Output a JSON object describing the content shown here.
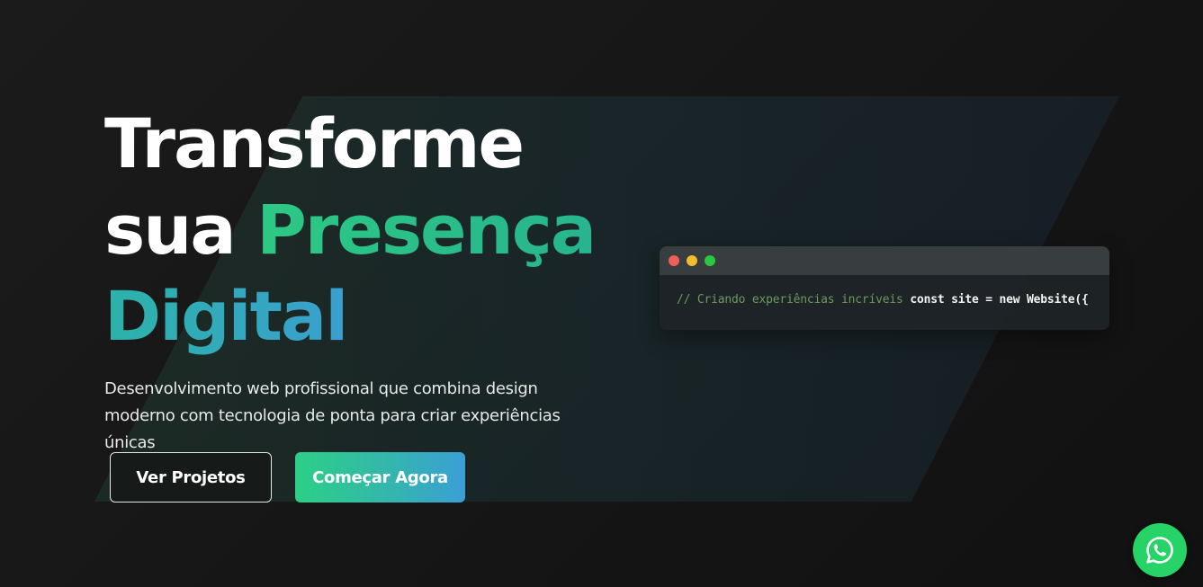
{
  "hero": {
    "title_line1": "Transforme",
    "title_line2_prefix": "sua ",
    "title_line2_highlight": "Presença",
    "title_line3": "Digital",
    "subtitle": "Desenvolvimento web profissional que combina design moderno com tecnologia de ponta para criar experiências únicas"
  },
  "buttons": {
    "secondary_label": "Ver Projetos",
    "primary_label": "Começar Agora"
  },
  "code_window": {
    "dots": [
      "#ee5f57",
      "#f1bc2f",
      "#2ac840"
    ],
    "comment": "// Criando experiências incríveis",
    "code": "const site = new Website({"
  },
  "floating": {
    "icon": "whatsapp-icon",
    "color": "#25d366"
  },
  "colors": {
    "accent_green": "#2cc983",
    "accent_blue": "#3a9fd0",
    "background": "#141414"
  }
}
